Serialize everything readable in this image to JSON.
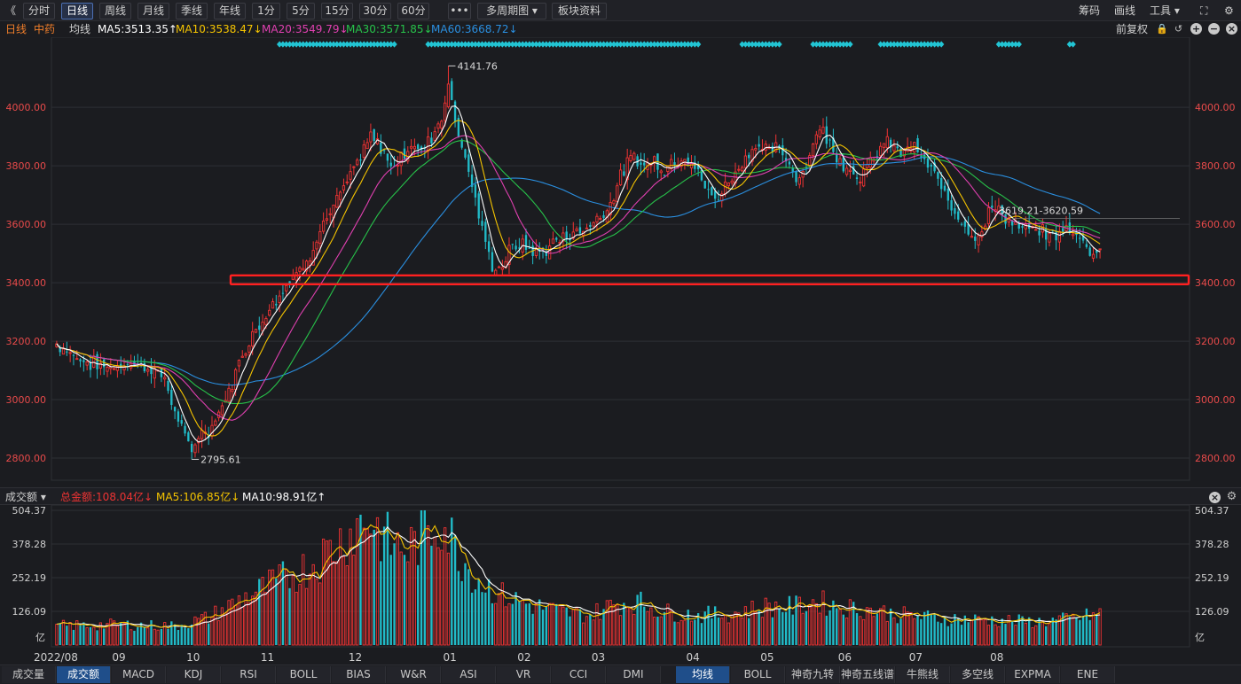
{
  "toolbar": {
    "left_chevron": "《",
    "periods": [
      {
        "label": "分时",
        "active": false
      },
      {
        "label": "日线",
        "active": true
      },
      {
        "label": "周线",
        "active": false
      },
      {
        "label": "月线",
        "active": false
      },
      {
        "label": "季线",
        "active": false
      },
      {
        "label": "年线",
        "active": false
      },
      {
        "label": "1分",
        "active": false
      },
      {
        "label": "5分",
        "active": false
      },
      {
        "label": "15分",
        "active": false
      },
      {
        "label": "30分",
        "active": false
      },
      {
        "label": "60分",
        "active": false
      }
    ],
    "more": "•••",
    "multi_period": "多周期图 ▾",
    "sector_info": "板块资料",
    "right": {
      "chips": "筹码",
      "draw": "画线",
      "tools": "工具 ▾",
      "fullscreen": "⛶",
      "settings": "⚙"
    }
  },
  "legend": {
    "period": "日线",
    "index": "中药",
    "ma_label": "均线",
    "ma5": "MA5:3513.35↑",
    "ma10": "MA10:3538.47↓",
    "ma20": "MA20:3549.79↓",
    "ma30": "MA30:3571.85↓",
    "ma60": "MA60:3668.72↓",
    "adjust": "前复权"
  },
  "colors": {
    "up": "#ee3333",
    "down": "#21bbc8",
    "ma5": "#ffffff",
    "ma10": "#f5c400",
    "ma20": "#e040b0",
    "ma30": "#27c24a",
    "ma60": "#2a8fe0",
    "grid": "#2e2f35",
    "axis_text": "#e84a4a",
    "highlight_box": "#ff2020"
  },
  "price_axis": {
    "min": 2700,
    "max": 4240,
    "ticks": [
      "4000.00",
      "3800.00",
      "3600.00",
      "3400.00",
      "3200.00",
      "3000.00",
      "2800.00"
    ]
  },
  "annotations": {
    "high": "4141.76",
    "low": "2795.61",
    "last_range": "3619.21-3620.59",
    "support_level": 3410
  },
  "date_axis": [
    "2022/08",
    "09",
    "10",
    "11",
    "12",
    "01",
    "02",
    "03",
    "04",
    "05",
    "06",
    "07",
    "08"
  ],
  "volume": {
    "header_label": "成交额 ▾",
    "total": "总金额:108.04亿↓",
    "ma5": "MA5:106.85亿↓",
    "ma10": "MA10:98.91亿↑",
    "ticks": [
      "504.37",
      "378.28",
      "252.19",
      "126.09"
    ],
    "unit": "亿",
    "max": 504.37
  },
  "tabs_left": [
    "成交量",
    "成交额",
    "MACD",
    "KDJ",
    "RSI",
    "BOLL",
    "BIAS",
    "W&R",
    "ASI",
    "VR",
    "CCI",
    "DMI"
  ],
  "tabs_left_active": "成交额",
  "tabs_right": [
    "均线",
    "BOLL",
    "神奇九转",
    "神奇五线谱",
    "牛熊线",
    "多空线",
    "EXPMA",
    "ENE"
  ],
  "tabs_right_active": "均线",
  "chart_data": {
    "type": "candlestick",
    "title": "中药 日线",
    "keypoints": [
      [
        0,
        3190
      ],
      [
        8,
        3130
      ],
      [
        15,
        3110
      ],
      [
        22,
        3125
      ],
      [
        27,
        3115
      ],
      [
        32,
        3070
      ],
      [
        35,
        2960
      ],
      [
        38,
        2860
      ],
      [
        40,
        2830
      ],
      [
        42,
        2880
      ],
      [
        45,
        2890
      ],
      [
        48,
        2950
      ],
      [
        51,
        3030
      ],
      [
        54,
        3120
      ],
      [
        57,
        3210
      ],
      [
        60,
        3250
      ],
      [
        63,
        3320
      ],
      [
        66,
        3360
      ],
      [
        69,
        3410
      ],
      [
        72,
        3440
      ],
      [
        75,
        3500
      ],
      [
        78,
        3580
      ],
      [
        81,
        3640
      ],
      [
        84,
        3700
      ],
      [
        87,
        3760
      ],
      [
        90,
        3830
      ],
      [
        93,
        3900
      ],
      [
        96,
        3860
      ],
      [
        99,
        3800
      ],
      [
        102,
        3830
      ],
      [
        105,
        3870
      ],
      [
        108,
        3850
      ],
      [
        111,
        3900
      ],
      [
        114,
        3970
      ],
      [
        116,
        4080
      ],
      [
        118,
        3960
      ],
      [
        120,
        3870
      ],
      [
        123,
        3740
      ],
      [
        126,
        3570
      ],
      [
        129,
        3460
      ],
      [
        131,
        3440
      ],
      [
        134,
        3510
      ],
      [
        138,
        3530
      ],
      [
        142,
        3500
      ],
      [
        146,
        3520
      ],
      [
        150,
        3560
      ],
      [
        154,
        3570
      ],
      [
        158,
        3600
      ],
      [
        162,
        3640
      ],
      [
        165,
        3700
      ],
      [
        168,
        3790
      ],
      [
        171,
        3830
      ],
      [
        174,
        3800
      ],
      [
        177,
        3820
      ],
      [
        180,
        3790
      ],
      [
        183,
        3820
      ],
      [
        186,
        3840
      ],
      [
        189,
        3790
      ],
      [
        192,
        3730
      ],
      [
        195,
        3680
      ],
      [
        198,
        3730
      ],
      [
        201,
        3780
      ],
      [
        204,
        3830
      ],
      [
        207,
        3870
      ],
      [
        210,
        3850
      ],
      [
        213,
        3860
      ],
      [
        216,
        3820
      ],
      [
        219,
        3760
      ],
      [
        222,
        3800
      ],
      [
        225,
        3910
      ],
      [
        227,
        3930
      ],
      [
        229,
        3870
      ],
      [
        232,
        3820
      ],
      [
        235,
        3790
      ],
      [
        238,
        3760
      ],
      [
        241,
        3810
      ],
      [
        244,
        3860
      ],
      [
        247,
        3880
      ],
      [
        250,
        3840
      ],
      [
        253,
        3870
      ],
      [
        256,
        3830
      ],
      [
        259,
        3780
      ],
      [
        262,
        3730
      ],
      [
        265,
        3660
      ],
      [
        268,
        3620
      ],
      [
        271,
        3560
      ],
      [
        274,
        3580
      ],
      [
        277,
        3660
      ],
      [
        280,
        3640
      ],
      [
        283,
        3600
      ],
      [
        286,
        3580
      ],
      [
        289,
        3580
      ],
      [
        292,
        3570
      ],
      [
        295,
        3560
      ],
      [
        298,
        3580
      ],
      [
        301,
        3570
      ],
      [
        304,
        3550
      ],
      [
        307,
        3490
      ],
      [
        309,
        3510
      ]
    ],
    "volume_keypoints": [
      [
        0,
        70
      ],
      [
        20,
        75
      ],
      [
        35,
        70
      ],
      [
        45,
        100
      ],
      [
        55,
        170
      ],
      [
        65,
        230
      ],
      [
        75,
        290
      ],
      [
        85,
        390
      ],
      [
        92,
        470
      ],
      [
        98,
        380
      ],
      [
        104,
        350
      ],
      [
        110,
        420
      ],
      [
        114,
        470
      ],
      [
        118,
        360
      ],
      [
        124,
        250
      ],
      [
        132,
        180
      ],
      [
        140,
        150
      ],
      [
        150,
        120
      ],
      [
        158,
        110
      ],
      [
        165,
        150
      ],
      [
        172,
        160
      ],
      [
        180,
        120
      ],
      [
        190,
        110
      ],
      [
        200,
        115
      ],
      [
        210,
        140
      ],
      [
        218,
        140
      ],
      [
        225,
        160
      ],
      [
        232,
        140
      ],
      [
        240,
        130
      ],
      [
        250,
        110
      ],
      [
        260,
        100
      ],
      [
        270,
        95
      ],
      [
        280,
        90
      ],
      [
        290,
        85
      ],
      [
        300,
        95
      ],
      [
        309,
        115
      ]
    ],
    "ma_values": {
      "ma5": 3513.35,
      "ma10": 3538.47,
      "ma20": 3549.79,
      "ma30": 3571.85,
      "ma60": 3668.72
    },
    "ylim": [
      2700,
      4240
    ]
  }
}
